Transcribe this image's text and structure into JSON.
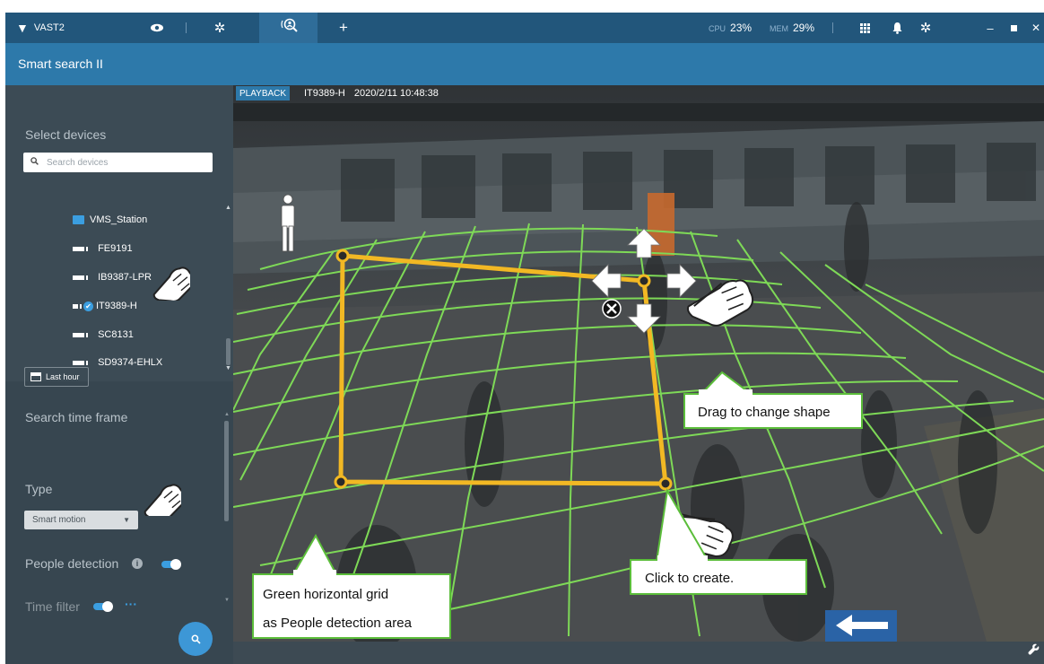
{
  "app": {
    "title": "VAST2",
    "cpu_label": "CPU",
    "cpu_value": "23%",
    "mem_label": "MEM",
    "mem_value": "29%"
  },
  "header": {
    "title": "Smart search II"
  },
  "sidebar": {
    "select_devices_label": "Select devices",
    "search_placeholder": "Search devices",
    "station": "VMS_Station",
    "devices": [
      {
        "label": "FE9191",
        "selected": false
      },
      {
        "label": "IB9387-LPR",
        "selected": false
      },
      {
        "label": "IT9389-H",
        "selected": true
      },
      {
        "label": "SC8131",
        "selected": false
      },
      {
        "label": "SD9374-EHLX",
        "selected": false
      }
    ],
    "time_frame_label": "Search time frame",
    "last_hour_label": "Last hour",
    "type_label": "Type",
    "type_value": "Smart motion",
    "people_detection_label": "People detection",
    "people_detection_on": true,
    "time_filter_label": "Time filter",
    "time_filter_on": true
  },
  "video": {
    "playback_badge": "PLAYBACK",
    "camera": "IT9389-H",
    "timestamp": "2020/2/11 10:48:38"
  },
  "annotations": {
    "drag": "Drag to change shape",
    "click": "Click to create.",
    "grid_line1": "Green horizontal grid",
    "grid_line2": "as People detection area"
  },
  "colors": {
    "topbar": "#22567b",
    "subbar": "#2d79aa",
    "accent": "#3b9ee0",
    "grid": "#7ed957",
    "polygon": "#f2b824",
    "callout_border": "#5bbd3a"
  },
  "icons": {
    "view": "eye-icon",
    "settings": "gear-icon",
    "smart_search": "person-search-icon",
    "add": "plus-icon",
    "apps": "grid-icon",
    "notifications": "bell-icon",
    "search": "magnifier-icon",
    "tools": "wrench-icon"
  }
}
